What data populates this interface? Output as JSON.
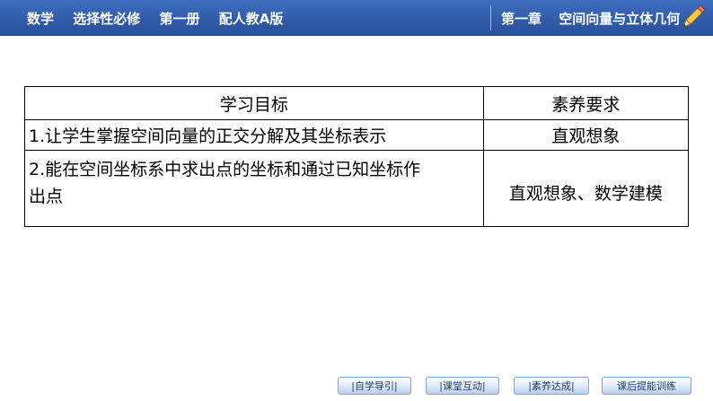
{
  "header": {
    "left_items": [
      "数学",
      "选择性必修",
      "第一册",
      "配人教A版"
    ],
    "right_items": [
      "第一章",
      "空间向量与立体几何"
    ],
    "accent_color": "#2f5aa8"
  },
  "table": {
    "headers": [
      "学习目标",
      "素养要求"
    ],
    "rows": [
      {
        "goal": "1.让学生掌握空间向量的正交分解及其坐标表示",
        "literacy": "直观想象"
      },
      {
        "goal_line1": "2.能在空间坐标系中求出点的坐标和通过已知坐标作",
        "goal_line2": "出点",
        "literacy": "直观想象、数学建模"
      }
    ]
  },
  "nav": {
    "buttons": [
      "|自学导引|",
      "|课堂互动|",
      "|素养达成|",
      "课后提能训练"
    ]
  }
}
